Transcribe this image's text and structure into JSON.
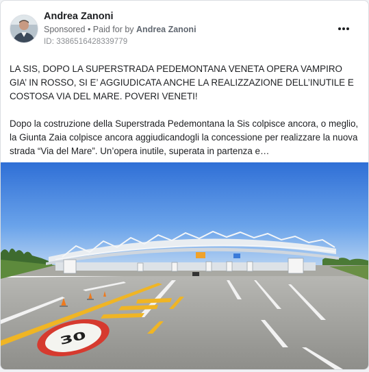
{
  "post": {
    "author": "Andrea Zanoni",
    "sponsored_label": "Sponsored",
    "separator": " • ",
    "paid_for_label": "Paid for by ",
    "paid_for_name": "Andrea Zanoni",
    "ad_id": "ID: 3386516428339779",
    "headline": "LA SIS, DOPO LA SUPERSTRADA PEDEMONTANA VENETA OPERA VAMPIRO GIA’ IN ROSSO, SI E’ AGGIUDICATA ANCHE LA REALIZZAZIONE DELL’INUTILE E COSTOSA VIA DEL MARE. POVERI VENETI!",
    "body": "Dopo la costruzione della Superstrada Pedemontana la Sis colpisce ancora, o meglio, la Giunta Zaia colpisce ancora aggiudicandogli la concessione per realizzare la nuova strada “Via del Mare”. Un’opera inutile, superata in partenza e…",
    "road_sign_speed": "30",
    "icons": {
      "avatar": "profile-photo",
      "more": "more-options-icon",
      "image": "highway-toll-plaza-photo"
    }
  }
}
